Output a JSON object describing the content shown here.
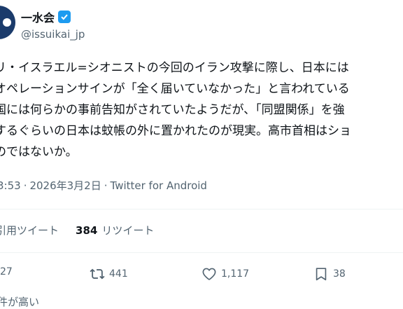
{
  "author": {
    "name": "一水会",
    "handle": "@issuikai_jp"
  },
  "tweet": {
    "lines": [
      "リ・イスラエル=シオニストの今回のイラン攻撃に際し、日本には",
      "オペレーションサインが「全く届いていなかった」と言われている",
      "国には何らかの事前告知がされていたようだが、「同盟関係」を強",
      "するぐらいの日本は蚊帳の外に置かれたのが現実。高市首相はショ",
      "のではないか。"
    ],
    "time": "3:53",
    "date": "2026年3月2日",
    "separator": "·",
    "app": "Twitter for Android"
  },
  "stats": {
    "quote_label": "引用ツイート",
    "retweet_count": "384",
    "retweet_label": "リツイート"
  },
  "actions": {
    "reply_count": "27",
    "retweet_count": "441",
    "like_count": "1,117",
    "bookmark_count": "38"
  },
  "footer": {
    "text": "件が高い"
  },
  "colors": {
    "accent": "#1d9bf0",
    "text": "#0f1419",
    "muted": "#536471"
  }
}
